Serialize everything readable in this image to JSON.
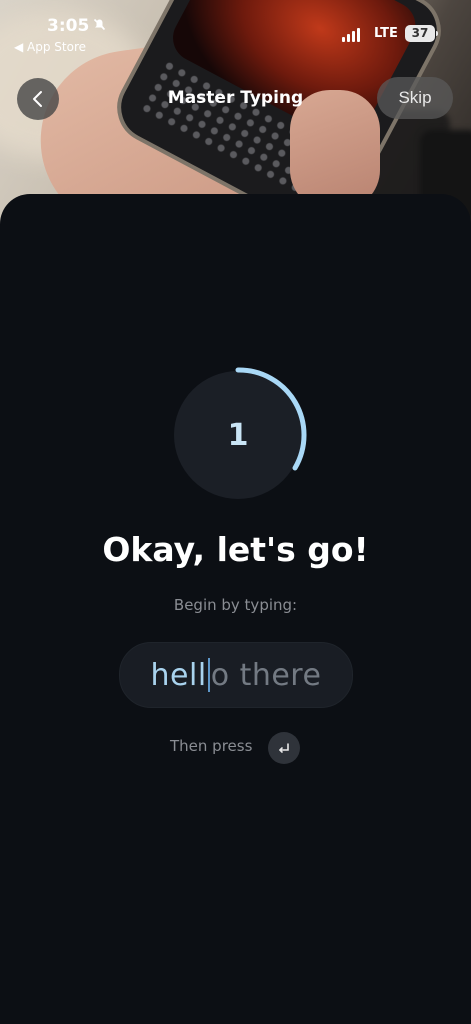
{
  "status_bar": {
    "time": "3:05",
    "back_app": "◀ App Store",
    "network": "LTE",
    "battery": "37"
  },
  "nav": {
    "title": "Master Typing",
    "skip_label": "Skip"
  },
  "countdown": {
    "number": "1",
    "ring_color": "#a9d8f6"
  },
  "content": {
    "heading": "Okay, let's go!",
    "instruction": "Begin by typing:",
    "phrase_typed": "hell",
    "phrase_remaining": "o there",
    "then_press": "Then press"
  },
  "icons": {
    "back": "chevron-left-icon",
    "enter": "return-key-icon",
    "mute": "bell-slash-icon"
  }
}
